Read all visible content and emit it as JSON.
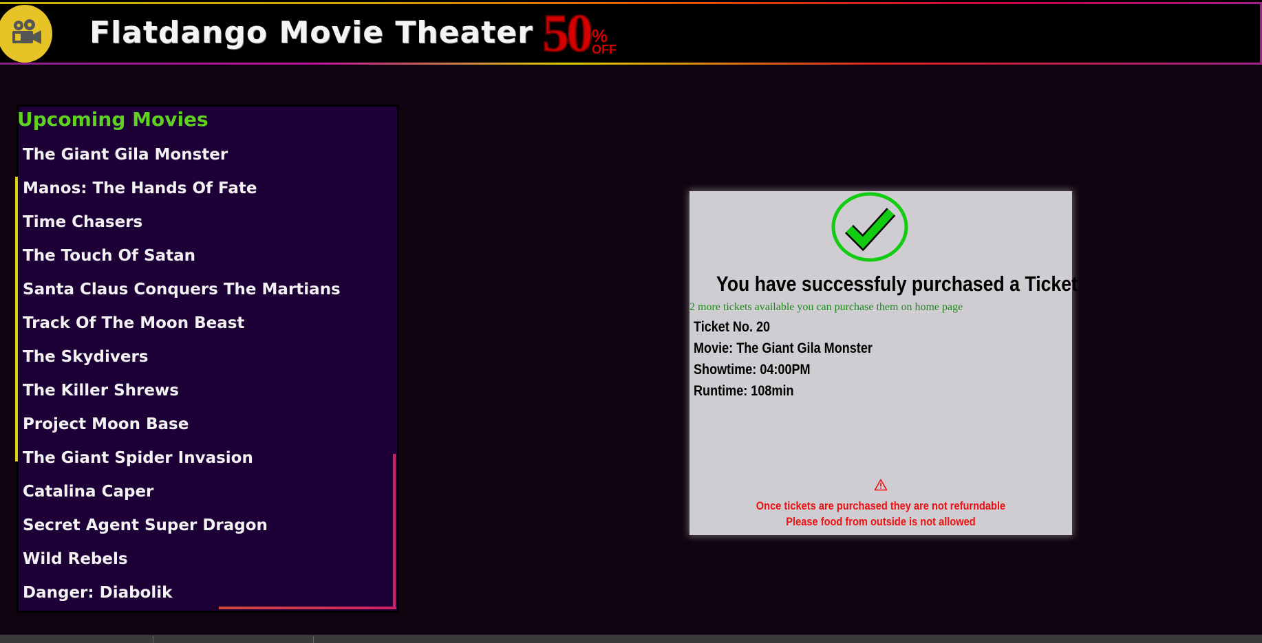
{
  "header": {
    "title": "Flatdango Movie Theater",
    "promo": {
      "number": "50",
      "percent": "%",
      "off": "OFF"
    },
    "logo_icon": "movie-camera-icon"
  },
  "sidebar": {
    "title": "Upcoming Movies",
    "movies": [
      "The Giant Gila Monster",
      "Manos: The Hands Of Fate",
      "Time Chasers",
      "The Touch Of Satan",
      "Santa Claus Conquers The Martians",
      "Track Of The Moon Beast",
      "The Skydivers",
      "The Killer Shrews",
      "Project Moon Base",
      "The Giant Spider Invasion",
      "Catalina Caper",
      "Secret Agent Super Dragon",
      "Wild Rebels",
      "Danger: Diabolik"
    ]
  },
  "ticket": {
    "icon": "check-circle-icon",
    "title": "You have successfuly purchased a Ticket",
    "availability": "2 more tickets available you can purchase them on home page",
    "ticket_no": "Ticket No. 20",
    "movie": "Movie: The Giant Gila Monster",
    "showtime": "Showtime: 04:00PM",
    "runtime": "Runtime: 108min",
    "warning_icon": "warning-triangle-icon",
    "warning_1": "Once tickets are purchased they are not refurndable",
    "warning_2": "Please food from outside is not allowed"
  },
  "colors": {
    "background": "#0f0410",
    "sidebar_bg": "#1c0036",
    "sidebar_title": "#5fd11f",
    "check_green": "#11cc11",
    "warning_red": "#ee1111",
    "promo_red": "#d40000"
  }
}
